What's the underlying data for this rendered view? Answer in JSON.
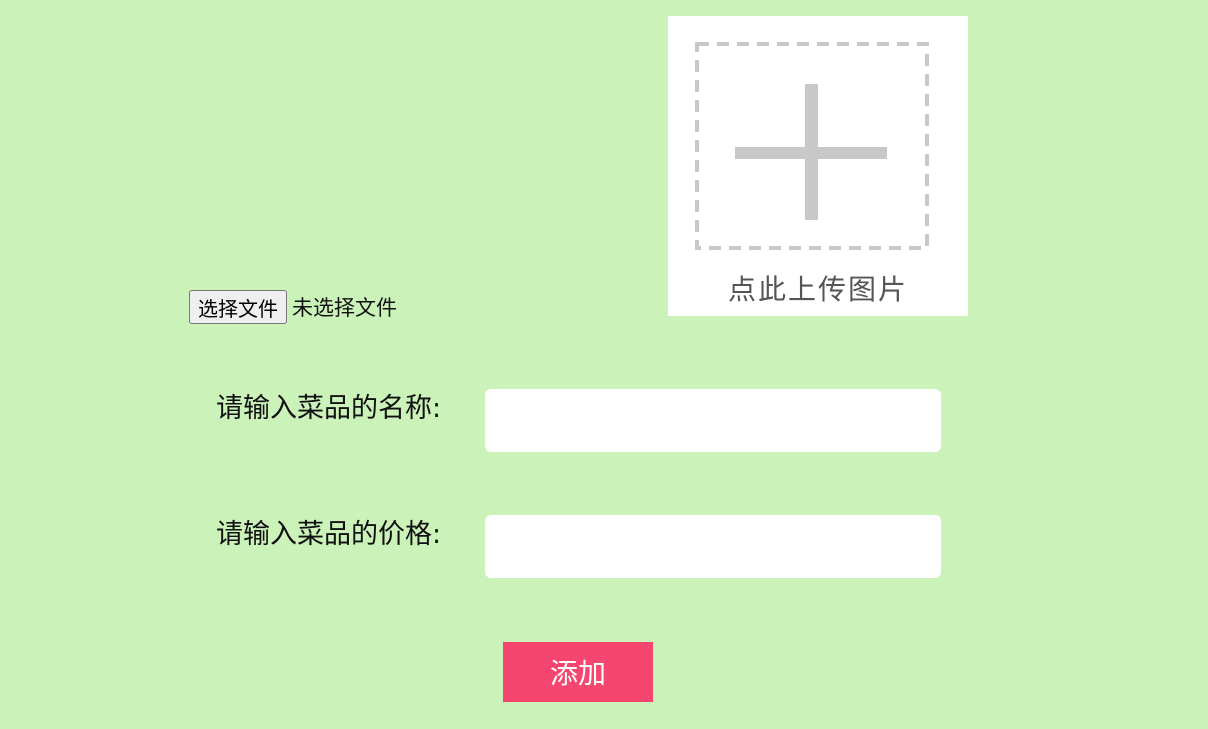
{
  "upload": {
    "icon": "plus-icon",
    "text": "点此上传图片"
  },
  "file_input": {
    "button_label": "选择文件",
    "status": "未选择文件"
  },
  "form": {
    "name_label": "请输入菜品的名称:",
    "name_value": "",
    "price_label": "请输入菜品的价格:",
    "price_value": ""
  },
  "submit": {
    "label": "添加"
  },
  "colors": {
    "background": "#caf2b9",
    "button": "#f5466f",
    "placeholder_icon": "#c8c8c8"
  }
}
